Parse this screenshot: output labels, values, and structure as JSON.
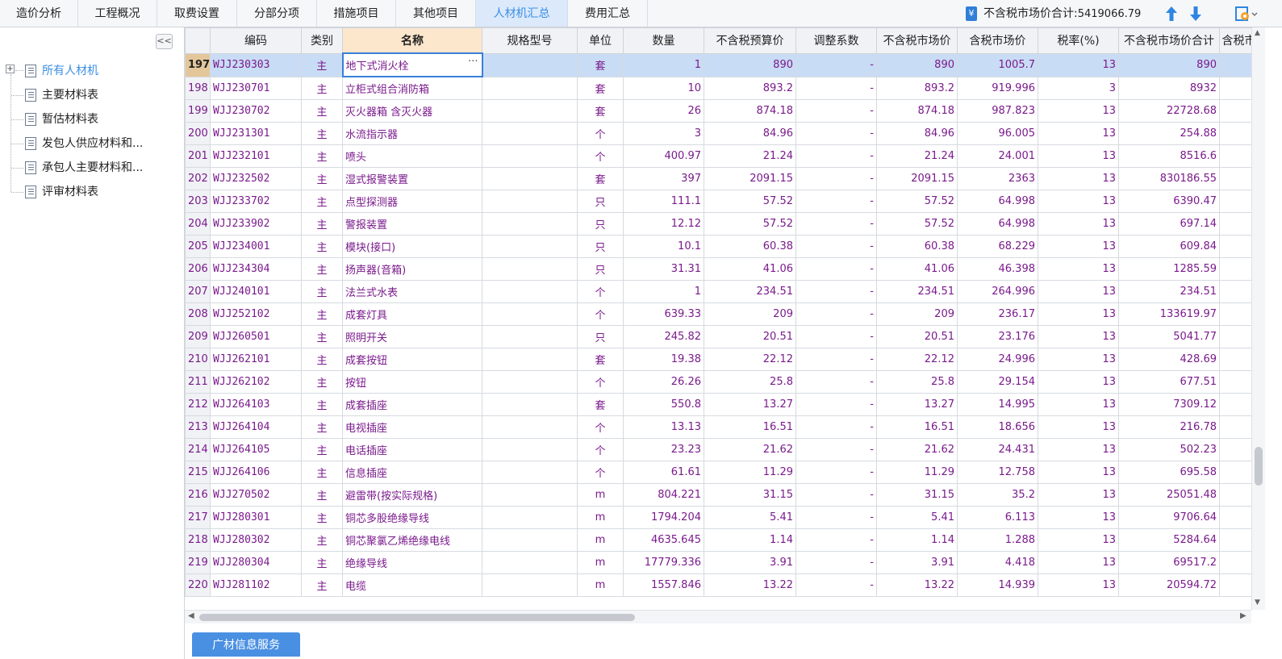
{
  "tabs": [
    {
      "label": "造价分析",
      "active": false
    },
    {
      "label": "工程概况",
      "active": false
    },
    {
      "label": "取费设置",
      "active": false
    },
    {
      "label": "分部分项",
      "active": false
    },
    {
      "label": "措施项目",
      "active": false
    },
    {
      "label": "其他项目",
      "active": false
    },
    {
      "label": "人材机汇总",
      "active": true
    },
    {
      "label": "费用汇总",
      "active": false
    }
  ],
  "summary": {
    "icon": "yen-icon",
    "label": "不含税市场价合计",
    "value": "5419066.79"
  },
  "tree": {
    "collapse_label": "<<",
    "expander": "+",
    "items": [
      {
        "label": "所有人材机",
        "selected": true
      },
      {
        "label": "主要材料表"
      },
      {
        "label": "暂估材料表"
      },
      {
        "label": "发包人供应材料和..."
      },
      {
        "label": "承包人主要材料和..."
      },
      {
        "label": "评审材料表"
      }
    ]
  },
  "grid": {
    "headers": [
      "编码",
      "类别",
      "名称",
      "规格型号",
      "单位",
      "数量",
      "不含税预算价",
      "调整系数",
      "不含税市场价",
      "含税市场价",
      "税率(%)",
      "不含税市场价合计",
      "含税市"
    ],
    "rows": [
      [
        "197",
        "WJJ230303",
        "主",
        "地下式消火栓",
        "",
        "套",
        "1",
        "890",
        "-",
        "890",
        "1005.7",
        "13",
        "890"
      ],
      [
        "198",
        "WJJ230701",
        "主",
        "立柜式组合消防箱",
        "",
        "套",
        "10",
        "893.2",
        "-",
        "893.2",
        "919.996",
        "3",
        "8932"
      ],
      [
        "199",
        "WJJ230702",
        "主",
        "灭火器箱 含灭火器",
        "",
        "套",
        "26",
        "874.18",
        "-",
        "874.18",
        "987.823",
        "13",
        "22728.68"
      ],
      [
        "200",
        "WJJ231301",
        "主",
        "水流指示器",
        "",
        "个",
        "3",
        "84.96",
        "-",
        "84.96",
        "96.005",
        "13",
        "254.88"
      ],
      [
        "201",
        "WJJ232101",
        "主",
        "喷头",
        "",
        "个",
        "400.97",
        "21.24",
        "-",
        "21.24",
        "24.001",
        "13",
        "8516.6"
      ],
      [
        "202",
        "WJJ232502",
        "主",
        "湿式报警装置",
        "",
        "套",
        "397",
        "2091.15",
        "-",
        "2091.15",
        "2363",
        "13",
        "830186.55"
      ],
      [
        "203",
        "WJJ233702",
        "主",
        "点型探测器",
        "",
        "只",
        "111.1",
        "57.52",
        "-",
        "57.52",
        "64.998",
        "13",
        "6390.47"
      ],
      [
        "204",
        "WJJ233902",
        "主",
        "警报装置",
        "",
        "只",
        "12.12",
        "57.52",
        "-",
        "57.52",
        "64.998",
        "13",
        "697.14"
      ],
      [
        "205",
        "WJJ234001",
        "主",
        "模块(接口)",
        "",
        "只",
        "10.1",
        "60.38",
        "-",
        "60.38",
        "68.229",
        "13",
        "609.84"
      ],
      [
        "206",
        "WJJ234304",
        "主",
        "扬声器(音箱)",
        "",
        "只",
        "31.31",
        "41.06",
        "-",
        "41.06",
        "46.398",
        "13",
        "1285.59"
      ],
      [
        "207",
        "WJJ240101",
        "主",
        "法兰式水表",
        "",
        "个",
        "1",
        "234.51",
        "-",
        "234.51",
        "264.996",
        "13",
        "234.51"
      ],
      [
        "208",
        "WJJ252102",
        "主",
        "成套灯具",
        "",
        "个",
        "639.33",
        "209",
        "-",
        "209",
        "236.17",
        "13",
        "133619.97"
      ],
      [
        "209",
        "WJJ260501",
        "主",
        "照明开关",
        "",
        "只",
        "245.82",
        "20.51",
        "-",
        "20.51",
        "23.176",
        "13",
        "5041.77"
      ],
      [
        "210",
        "WJJ262101",
        "主",
        "成套按钮",
        "",
        "套",
        "19.38",
        "22.12",
        "-",
        "22.12",
        "24.996",
        "13",
        "428.69"
      ],
      [
        "211",
        "WJJ262102",
        "主",
        "按钮",
        "",
        "个",
        "26.26",
        "25.8",
        "-",
        "25.8",
        "29.154",
        "13",
        "677.51"
      ],
      [
        "212",
        "WJJ264103",
        "主",
        "成套插座",
        "",
        "套",
        "550.8",
        "13.27",
        "-",
        "13.27",
        "14.995",
        "13",
        "7309.12"
      ],
      [
        "213",
        "WJJ264104",
        "主",
        "电视插座",
        "",
        "个",
        "13.13",
        "16.51",
        "-",
        "16.51",
        "18.656",
        "13",
        "216.78"
      ],
      [
        "214",
        "WJJ264105",
        "主",
        "电话插座",
        "",
        "个",
        "23.23",
        "21.62",
        "-",
        "21.62",
        "24.431",
        "13",
        "502.23"
      ],
      [
        "215",
        "WJJ264106",
        "主",
        "信息插座",
        "",
        "个",
        "61.61",
        "11.29",
        "-",
        "11.29",
        "12.758",
        "13",
        "695.58"
      ],
      [
        "216",
        "WJJ270502",
        "主",
        "避雷带(按实际规格)",
        "",
        "m",
        "804.221",
        "31.15",
        "-",
        "31.15",
        "35.2",
        "13",
        "25051.48"
      ],
      [
        "217",
        "WJJ280301",
        "主",
        "铜芯多股绝缘导线",
        "",
        "m",
        "1794.204",
        "5.41",
        "-",
        "5.41",
        "6.113",
        "13",
        "9706.64"
      ],
      [
        "218",
        "WJJ280302",
        "主",
        "铜芯聚氯乙烯绝缘电线",
        "",
        "m",
        "4635.645",
        "1.14",
        "-",
        "1.14",
        "1.288",
        "13",
        "5284.64"
      ],
      [
        "219",
        "WJJ280304",
        "主",
        "绝缘导线",
        "",
        "m",
        "17779.336",
        "3.91",
        "-",
        "3.91",
        "4.418",
        "13",
        "69517.2"
      ],
      [
        "220",
        "WJJ281102",
        "主",
        "电缆",
        "",
        "m",
        "1557.846",
        "13.22",
        "-",
        "13.22",
        "14.939",
        "13",
        "20594.72"
      ]
    ]
  },
  "bottom_button": "广材信息服务"
}
